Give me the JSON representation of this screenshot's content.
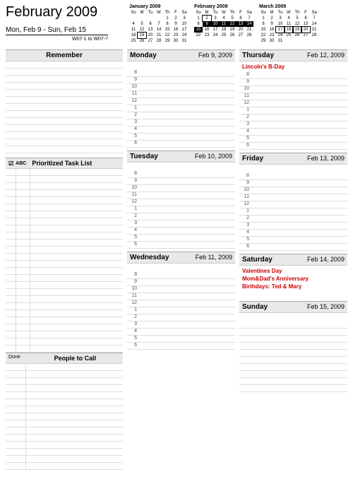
{
  "header": {
    "title": "February 2009",
    "range": "Mon, Feb 9  -  Sun, Feb 15",
    "weekcode": "W07-1 to W07-7"
  },
  "miniCals": [
    {
      "title": "January 2009",
      "dow": [
        "Su",
        "M",
        "Tu",
        "W",
        "Th",
        "F",
        "Sa"
      ],
      "rows": [
        [
          "",
          "",
          "",
          "",
          "1",
          "2",
          "3"
        ],
        [
          "4",
          "5",
          "6",
          "7",
          "8",
          "9",
          "10"
        ],
        [
          "11",
          "12",
          "13",
          "14",
          "15",
          "16",
          "17"
        ],
        [
          "18",
          "19",
          "20",
          "21",
          "22",
          "23",
          "24"
        ],
        [
          "25",
          "26",
          "27",
          "28",
          "29",
          "30",
          "31"
        ]
      ],
      "boxed": [
        "19"
      ]
    },
    {
      "title": "February 2009",
      "dow": [
        "Su",
        "M",
        "Tu",
        "W",
        "Th",
        "F",
        "Sa"
      ],
      "rows": [
        [
          "1",
          "2",
          "3",
          "4",
          "5",
          "6",
          "7"
        ],
        [
          "8",
          "9",
          "10",
          "11",
          "12",
          "13",
          "14"
        ],
        [
          "15",
          "16",
          "17",
          "18",
          "19",
          "20",
          "21"
        ],
        [
          "22",
          "23",
          "24",
          "25",
          "26",
          "27",
          "28"
        ]
      ],
      "highlighted": [
        "9",
        "10",
        "11",
        "12",
        "13",
        "14",
        "15"
      ],
      "boxed": [
        "2"
      ]
    },
    {
      "title": "March 2009",
      "dow": [
        "Su",
        "M",
        "Tu",
        "W",
        "Th",
        "F",
        "Sa"
      ],
      "rows": [
        [
          "1",
          "2",
          "3",
          "4",
          "5",
          "6",
          "7"
        ],
        [
          "8",
          "9",
          "10",
          "11",
          "12",
          "13",
          "14"
        ],
        [
          "15",
          "16",
          "17",
          "18",
          "19",
          "20",
          "21"
        ],
        [
          "22",
          "23",
          "24",
          "25",
          "26",
          "27",
          "28"
        ],
        [
          "29",
          "30",
          "31",
          "",
          "",
          "",
          ""
        ]
      ],
      "boxed": [
        "17",
        "18",
        "19",
        "20"
      ]
    }
  ],
  "sections": {
    "remember": "Remember",
    "tasks": {
      "label": "Prioritized Task List",
      "chk": "☑",
      "abc": "ABC"
    },
    "people": {
      "done": "Done",
      "label": "People to Call"
    }
  },
  "hours": [
    "8",
    "9",
    "10",
    "11",
    "12",
    "1",
    "2",
    "3",
    "4",
    "5",
    "6"
  ],
  "days": {
    "mon": {
      "name": "Monday",
      "date": "Feb 9, 2009",
      "events": []
    },
    "tue": {
      "name": "Tuesday",
      "date": "Feb 10, 2009",
      "events": []
    },
    "wed": {
      "name": "Wednesday",
      "date": "Feb 11, 2009",
      "events": []
    },
    "thu": {
      "name": "Thursday",
      "date": "Feb 12, 2009",
      "events": [
        "Lincoln's B-Day"
      ]
    },
    "fri": {
      "name": "Friday",
      "date": "Feb 13, 2009",
      "events": []
    },
    "sat": {
      "name": "Saturday",
      "date": "Feb 14, 2009",
      "events": [
        "Valentines Day",
        "Mom&Dad's Anniversary",
        "Birthdays: Ted & Mary"
      ]
    },
    "sun": {
      "name": "Sunday",
      "date": "Feb 15, 2009",
      "events": []
    }
  }
}
